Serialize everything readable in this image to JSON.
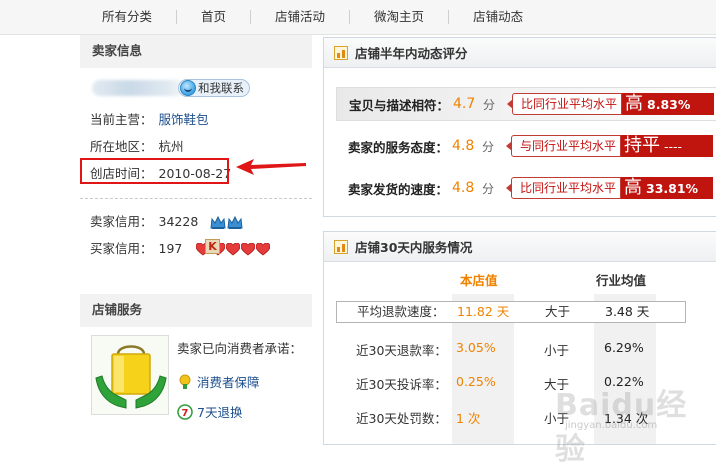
{
  "nav": {
    "items": [
      "所有分类",
      "首页",
      "店铺活动",
      "微淘主页",
      "店铺动态"
    ]
  },
  "seller": {
    "title": "卖家信息",
    "contact_label": "和我联系",
    "category_label": "当前主营：",
    "category_value": "服饰鞋包",
    "region_label": "所在地区：",
    "region_value": "杭州",
    "open_date_label": "创店时间：",
    "open_date_value": "2010-08-27",
    "seller_credit_label": "卖家信用：",
    "seller_credit_value": "34228",
    "buyer_credit_label": "买家信用：",
    "buyer_credit_value": "197"
  },
  "shop_service": {
    "title": "店铺服务",
    "promise_text": "卖家已向消费者承诺：",
    "items": [
      "消费者保障",
      "7天退换"
    ]
  },
  "rating_panel": {
    "title": "店铺半年内动态评分",
    "rows": [
      {
        "label": "宝贝与描述相符：",
        "score": "4.7",
        "unit": "分",
        "compare": "比同行业平均水平",
        "word": "高",
        "pct": "8.83%"
      },
      {
        "label": "卖家的服务态度：",
        "score": "4.8",
        "unit": "分",
        "compare": "与同行业平均水平",
        "word": "持平",
        "pct": "----"
      },
      {
        "label": "卖家发货的速度：",
        "score": "4.8",
        "unit": "分",
        "compare": "比同行业平均水平",
        "word": "高",
        "pct": "33.81%"
      }
    ]
  },
  "service_panel": {
    "title": "店铺30天内服务情况",
    "col_shop": "本店值",
    "col_industry": "行业均值",
    "rows": [
      {
        "name": "平均退款速度：",
        "shop": "11.82 天",
        "cmp": "大于",
        "industry": "3.48 天"
      },
      {
        "name": "近30天退款率：",
        "shop": "3.05%",
        "cmp": "小于",
        "industry": "6.29%"
      },
      {
        "name": "近30天投诉率：",
        "shop": "0.25%",
        "cmp": "大于",
        "industry": "0.22%"
      },
      {
        "name": "近30天处罚数：",
        "shop": "1 次",
        "cmp": "小于",
        "industry": "1.34 次"
      }
    ]
  },
  "watermark": {
    "brand": "Baidu经验",
    "url": "jingyan.baidu.com"
  },
  "colors": {
    "accent_orange": "#f08200",
    "badge_red": "#c0140f",
    "link_blue": "#1d4f8e",
    "highlight_red": "#e01515"
  }
}
